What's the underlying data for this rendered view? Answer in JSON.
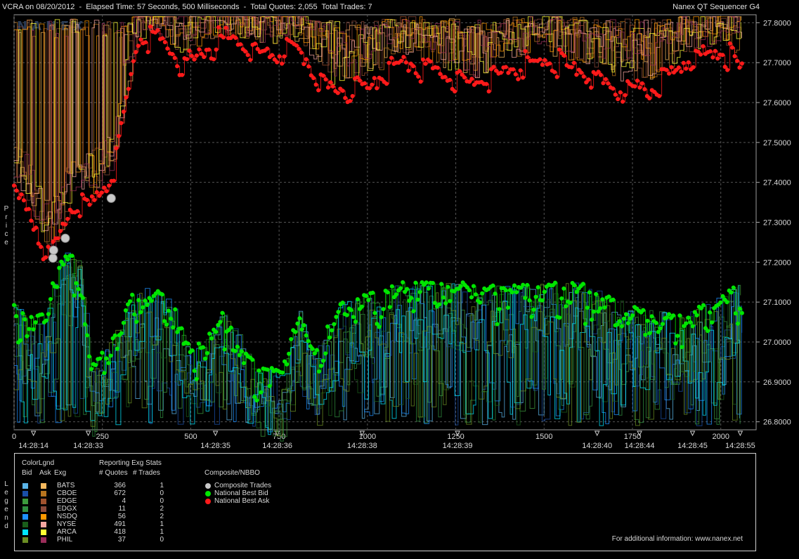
{
  "header": {
    "left": "VCRA on 08/20/2012  -  Elapsed Time: 57 Seconds, 500 Milliseconds  -  Total Quotes: 2,055  Total Trades: 7",
    "right": "Nanex QT Sequencer G4",
    "watermark": "NANEX"
  },
  "side_labels": {
    "price": "Price",
    "legend": "Legend"
  },
  "chart_data": {
    "type": "line",
    "title": "",
    "ylabel": "Price",
    "ylim": [
      26.78,
      27.82
    ],
    "xlim": [
      0,
      2100
    ],
    "y_ticks": [
      "27.8000",
      "27.7000",
      "27.6000",
      "27.5000",
      "27.4000",
      "27.3000",
      "27.2000",
      "27.1000",
      "27.0000",
      "26.9000",
      "26.8000"
    ],
    "x_ticks": [
      "0",
      "250",
      "500",
      "750",
      "1000",
      "1250",
      "1500",
      "1750",
      "2000"
    ],
    "time_labels": [
      {
        "x": 55,
        "label": "14:28:14"
      },
      {
        "x": 210,
        "label": "14:28:33"
      },
      {
        "x": 570,
        "label": "14:28:35"
      },
      {
        "x": 745,
        "label": "14:28:36"
      },
      {
        "x": 985,
        "label": "14:28:38"
      },
      {
        "x": 1255,
        "label": "14:28:39"
      },
      {
        "x": 1650,
        "label": "14:28:40"
      },
      {
        "x": 1770,
        "label": "14:28:44"
      },
      {
        "x": 1920,
        "label": "14:28:45"
      },
      {
        "x": 2055,
        "label": "14:28:55"
      }
    ],
    "composite_trades": [
      {
        "x": 110,
        "y": 27.21
      },
      {
        "x": 112,
        "y": 27.23
      },
      {
        "x": 145,
        "y": 27.26
      },
      {
        "x": 275,
        "y": 27.36
      }
    ],
    "series": [
      {
        "name": "National Best Bid",
        "color": "#00e600",
        "anchors": [
          [
            0,
            27.1
          ],
          [
            40,
            27.06
          ],
          [
            90,
            27.08
          ],
          [
            130,
            27.23
          ],
          [
            180,
            27.21
          ],
          [
            220,
            26.94
          ],
          [
            280,
            27.02
          ],
          [
            350,
            27.15
          ],
          [
            440,
            27.12
          ],
          [
            500,
            26.98
          ],
          [
            560,
            27.03
          ],
          [
            600,
            27.09
          ],
          [
            650,
            26.98
          ],
          [
            700,
            26.94
          ],
          [
            760,
            26.93
          ],
          [
            800,
            27.1
          ],
          [
            850,
            26.97
          ],
          [
            920,
            27.1
          ],
          [
            1000,
            27.12
          ],
          [
            1100,
            27.15
          ],
          [
            1200,
            27.15
          ],
          [
            1300,
            27.15
          ],
          [
            1400,
            27.14
          ],
          [
            1500,
            27.15
          ],
          [
            1600,
            27.15
          ],
          [
            1700,
            27.11
          ],
          [
            1800,
            27.08
          ],
          [
            1900,
            27.07
          ],
          [
            2000,
            27.12
          ],
          [
            2060,
            27.15
          ]
        ],
        "amp": 0.09,
        "count": 340
      },
      {
        "name": "National Best Ask",
        "color": "#ff1a1a",
        "anchors": [
          [
            0,
            27.38
          ],
          [
            40,
            27.35
          ],
          [
            100,
            27.22
          ],
          [
            160,
            27.35
          ],
          [
            220,
            27.36
          ],
          [
            280,
            27.44
          ],
          [
            350,
            27.78
          ],
          [
            400,
            27.78
          ],
          [
            480,
            27.71
          ],
          [
            600,
            27.78
          ],
          [
            700,
            27.74
          ],
          [
            800,
            27.75
          ],
          [
            900,
            27.64
          ],
          [
            1000,
            27.66
          ],
          [
            1100,
            27.72
          ],
          [
            1200,
            27.69
          ],
          [
            1300,
            27.66
          ],
          [
            1400,
            27.7
          ],
          [
            1500,
            27.72
          ],
          [
            1600,
            27.7
          ],
          [
            1700,
            27.65
          ],
          [
            1800,
            27.65
          ],
          [
            1900,
            27.72
          ],
          [
            2000,
            27.75
          ],
          [
            2060,
            27.7
          ]
        ],
        "amp": 0.09,
        "count": 300
      }
    ]
  },
  "legend": {
    "colorlgnd_title": "ColorLgnd",
    "col_bid": "Bid",
    "col_ask": "Ask",
    "col_exg": "Exg",
    "stats_title": "Reporting Exg Stats",
    "col_quotes": "# Quotes",
    "col_trades": "# Trades",
    "composite_title": "Composite/NBBO",
    "exchanges": [
      {
        "name": "BATS",
        "bid_color": "#5ab4e8",
        "ask_color": "#f5b95e",
        "quotes": "366",
        "trades": "1"
      },
      {
        "name": "CBOE",
        "bid_color": "#1a4fa8",
        "ask_color": "#b8741e",
        "quotes": "672",
        "trades": "0"
      },
      {
        "name": "EDGE",
        "bid_color": "#3c9a3c",
        "ask_color": "#a0522d",
        "quotes": "4",
        "trades": "0"
      },
      {
        "name": "EDGX",
        "bid_color": "#2f8f3f",
        "ask_color": "#8b4a3a",
        "quotes": "11",
        "trades": "2"
      },
      {
        "name": "NSDQ",
        "bid_color": "#1e90ff",
        "ask_color": "#ff9900",
        "quotes": "56",
        "trades": "2"
      },
      {
        "name": "NYSE",
        "bid_color": "#1a5e1a",
        "ask_color": "#f4a6a0",
        "quotes": "491",
        "trades": "1"
      },
      {
        "name": "ARCA",
        "bid_color": "#00e5ff",
        "ask_color": "#ffff33",
        "quotes": "418",
        "trades": "1"
      },
      {
        "name": "PHIL",
        "bid_color": "#6b8e23",
        "ask_color": "#9b2d5a",
        "quotes": "37",
        "trades": "0"
      }
    ],
    "composite_items": [
      {
        "label": "Composite Trades",
        "color": "#c8c8c8"
      },
      {
        "label": "National Best Bid",
        "color": "#00e600"
      },
      {
        "label": "National Best Ask",
        "color": "#ff1a1a"
      }
    ],
    "footer": "For additional information: www.nanex.net"
  }
}
